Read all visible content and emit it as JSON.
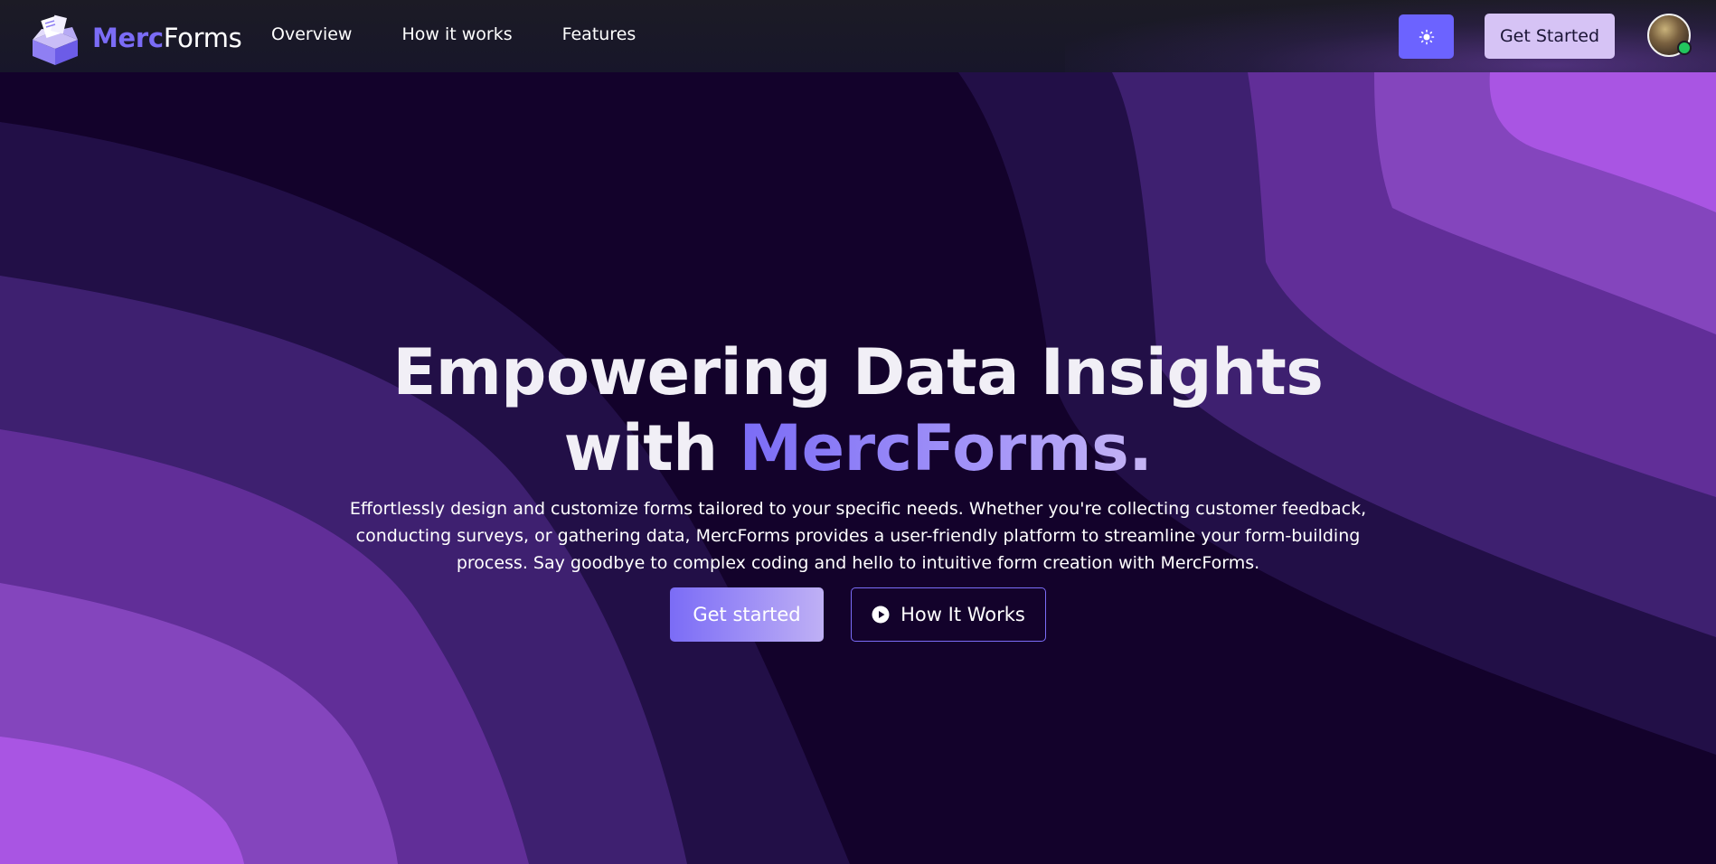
{
  "nav": {
    "brand_merc": "Merc",
    "brand_forms": "Forms",
    "links": [
      "Overview",
      "How it works",
      "Features"
    ],
    "cta_label": "Get Started",
    "theme_icon": "sun-icon",
    "avatar_status": "online"
  },
  "hero": {
    "title_line1": "Empowering Data Insights",
    "title_with": "with ",
    "title_accent": "MercForms.",
    "description": "Effortlessly design and customize forms tailored to your specific needs. Whether you're collecting customer feedback, conducting surveys, or gathering data, MercForms provides a user-friendly platform to streamline your form-building process. Say goodbye to complex coding and hello to intuitive form creation with MercForms.",
    "primary_button": "Get started",
    "secondary_button": "How It Works",
    "secondary_icon": "play-circle-icon"
  },
  "colors": {
    "accent": "#7b6cf6",
    "background": "#13022b",
    "nav_cta_bg": "#d6c3f5",
    "theme_button_bg": "#6c63ff",
    "status_online": "#22c55e"
  }
}
